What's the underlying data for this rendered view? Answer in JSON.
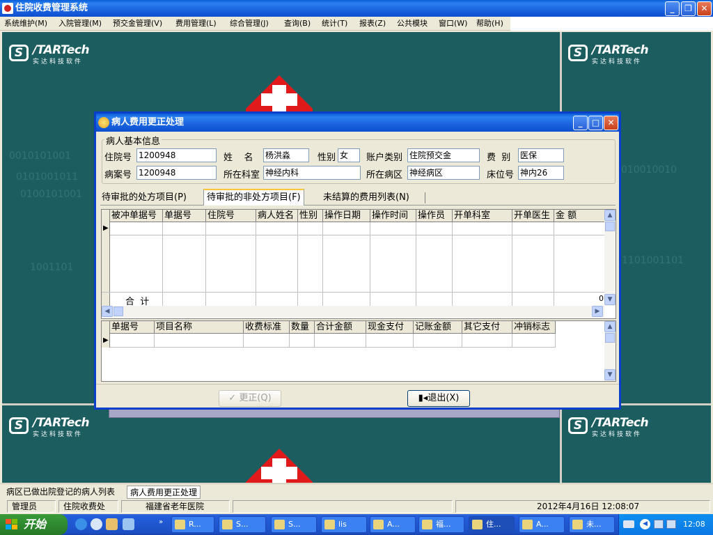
{
  "window": {
    "title": "住院收费管理系统",
    "controls": [
      "minimize-icon",
      "restore-icon",
      "close-icon"
    ]
  },
  "menu": [
    "系统维护(M)",
    "入院管理(M)",
    "预交金管理(V)",
    "费用管理(L)",
    "综合管理(J)",
    "查询(B)",
    "统计(T)",
    "报表(Z)",
    "公共模块",
    "窗口(W)",
    "帮助(H)"
  ],
  "logo": {
    "brand": "/TARTech",
    "letter": "S",
    "subtitle": "实达科技软件"
  },
  "dialog": {
    "title": "病人费用更正处理",
    "group_title": "病人基本信息",
    "fields": {
      "inpatient_no": {
        "label": "住院号",
        "value": "1200948"
      },
      "name": {
        "label": "姓    名",
        "value": "杨洪淼"
      },
      "sex": {
        "label": "性别",
        "value": "女"
      },
      "account_type": {
        "label": "账户类别",
        "value": "住院预交金"
      },
      "fee_type": {
        "label": "费  别",
        "value": "医保"
      },
      "case_no": {
        "label": "病案号",
        "value": "1200948"
      },
      "department": {
        "label": "所在科室",
        "value": "神经内科"
      },
      "ward": {
        "label": "所在病区",
        "value": "神经病区"
      },
      "bed_no": {
        "label": "床位号",
        "value": "神内26"
      }
    },
    "tabs": [
      "待审批的处方项目(P)",
      "待审批的非处方项目(F)",
      "未结算的费用列表(N)"
    ],
    "active_tab": 1,
    "upper_grid": {
      "columns": [
        "被冲单据号",
        "单据号",
        "住院号",
        "病人姓名",
        "性别",
        "操作日期",
        "操作时间",
        "操作员",
        "开单科室",
        "开单医生",
        "金  额"
      ],
      "total_label": "合  计",
      "total_value": "0"
    },
    "lower_grid": {
      "columns": [
        "单据号",
        "项目名称",
        "收费标准",
        "数量",
        "合计金额",
        "现金支付",
        "记账金额",
        "其它支付",
        "冲销标志"
      ]
    },
    "buttons": {
      "correct": "更正(Q)",
      "exit": "退出(X)"
    }
  },
  "doc_tabs": [
    "病区已做出院登记的病人列表",
    "病人费用更正处理"
  ],
  "status_bar": {
    "user": "管理员",
    "office": "住院收费处",
    "hospital": "福建省老年医院",
    "datetime": "2012年4月16日 12:08:07"
  },
  "taskbar": {
    "start": "开始",
    "items": [
      "R...",
      "S...",
      "S...",
      "lis",
      "A...",
      "福...",
      "住...",
      "A...",
      "未..."
    ],
    "active_item": 6,
    "clock": "12:08"
  }
}
